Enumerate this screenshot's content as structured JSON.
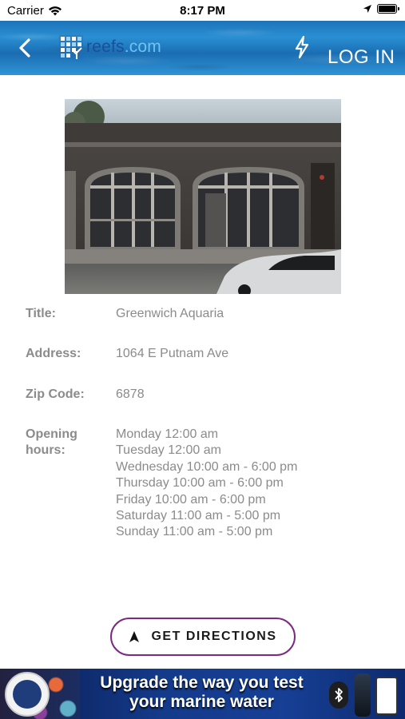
{
  "status_bar": {
    "carrier": "Carrier",
    "time": "8:17 PM"
  },
  "header": {
    "logo_text_dark": "reefs",
    "logo_text_light": ".com",
    "login_label": "LOG IN",
    "color": "#2a8fd3"
  },
  "details": {
    "title_label": "Title:",
    "title_value": "Greenwich Aquaria",
    "address_label": "Address:",
    "address_value": "1064 E Putnam Ave",
    "zip_label": "Zip Code:",
    "zip_value": "6878",
    "hours_label_line1": "Opening",
    "hours_label_line2": "hours:",
    "hours": [
      "Monday 12:00 am",
      "Tuesday 12:00 am",
      "Wednesday 10:00 am - 6:00 pm",
      "Thursday 10:00 am - 6:00 pm",
      "Friday 10:00 am - 6:00 pm",
      "Saturday 11:00 am - 5:00 pm",
      "Sunday 11:00 am - 5:00 pm"
    ]
  },
  "directions_button": {
    "label": "GET DIRECTIONS",
    "border_color": "#7b2a82"
  },
  "ad": {
    "line1": "Upgrade the way you test",
    "line2": "your marine water"
  }
}
